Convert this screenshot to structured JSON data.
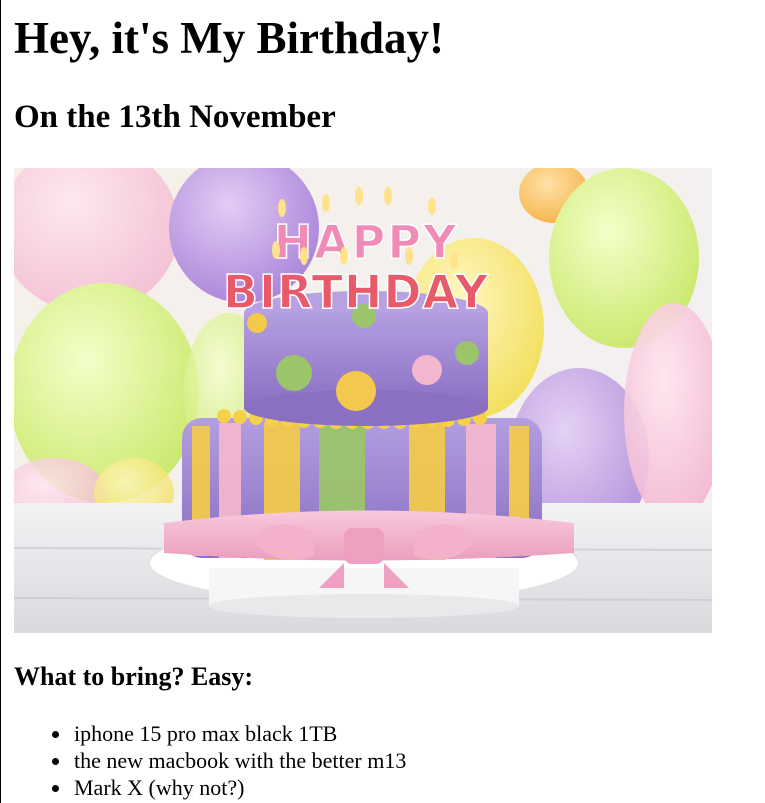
{
  "page": {
    "title": "Hey, it's My Birthday!",
    "subtitle": "On the 13th November"
  },
  "hero_image": {
    "cake_top_text": "HAPPY",
    "cake_bottom_text": "BIRTHDAY"
  },
  "bring": {
    "heading": "What to bring? Easy:",
    "items": [
      "iphone 15 pro max black 1TB",
      "the new macbook with the better m13",
      "Mark X (why not?)"
    ]
  },
  "colors": {
    "text": "#000000",
    "background": "#ffffff",
    "cake_purple": "#9b82c9",
    "cake_pink": "#f3b6cf",
    "cake_yellow": "#f2c94c",
    "cake_green": "#9cc46b"
  }
}
